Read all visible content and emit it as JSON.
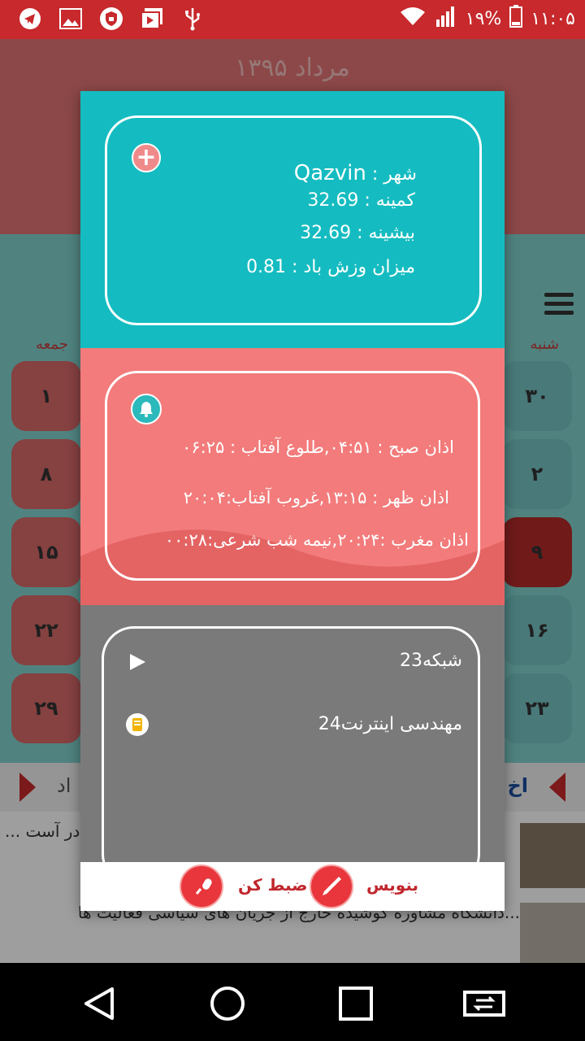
{
  "status_bar": {
    "time": "۱۱:۰۵",
    "battery": "۱۹%",
    "icons": [
      "telegram-icon",
      "image-icon",
      "shield-icon",
      "photo-album-icon",
      "usb-icon",
      "wifi-icon",
      "signal-icon",
      "battery-icon"
    ]
  },
  "background_app": {
    "month_title": "مرداد ۱۳۹۵",
    "day_left": "جمعه",
    "day_right": "شنبه",
    "left_column": [
      "۱",
      "۸",
      "۱۵",
      "۲۲",
      "۲۹"
    ],
    "right_column": [
      "۳۰",
      "۲",
      "۹",
      "۱۶",
      "۲۳"
    ],
    "news_header_left": "اد",
    "news_header_right": "اخ",
    "news_line_1": "... در آست",
    "news_line_1_prefix": "ت",
    "news_line_2": "دانشگاه مشاوره کوشیده خارج از جریان های سیاسی فعالیت ها..."
  },
  "weather": {
    "city_label": "شهر :",
    "city_value": "Qazvin",
    "min_label": "کمینه :",
    "min_value": "32.69",
    "max_label": "بیشینه :",
    "max_value": "32.69",
    "wind_label": "میزان وزش باد :",
    "wind_value": "0.81"
  },
  "prayer": {
    "line1": "اذان صبح : ۰۴:۵۱,طلوع آفتاب : ۰۶:۲۵",
    "line2": "اذان ظهر : ۱۳:۱۵,غروب آفتاب:۲۰:۰۴",
    "line3": "اذان مغرب :۲۰:۲۴,نیمه شب شرعی:۰۰:۲۸"
  },
  "tv": {
    "channel": "شبکه23",
    "program": "مهندسی اینترنت24"
  },
  "footer": {
    "write_label": "بنویس",
    "record_label": "ضبط کن"
  },
  "colors": {
    "status_bar": "#c7292c",
    "weather_panel": "#14bcc1",
    "prayer_panel": "#f37b7b",
    "tv_panel": "#7a7a7a",
    "accent_red": "#e8363c"
  }
}
